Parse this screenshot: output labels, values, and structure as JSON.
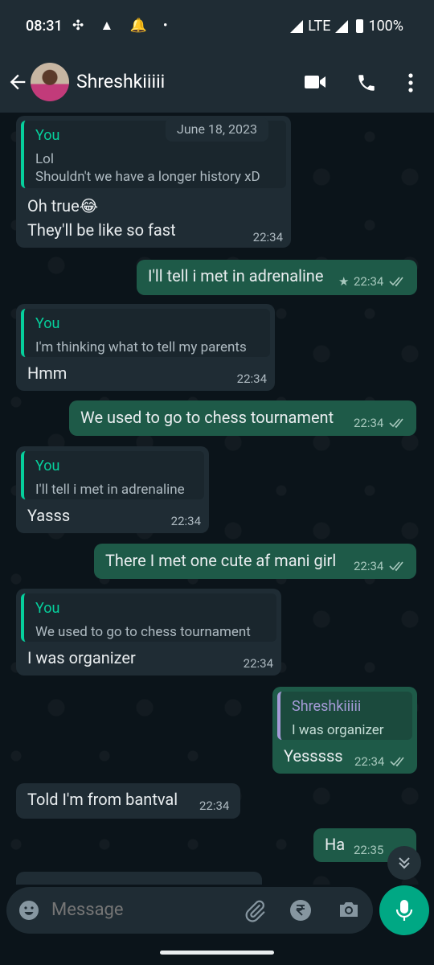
{
  "status": {
    "time": "08:31",
    "network": "LTE",
    "battery": "100%"
  },
  "header": {
    "contact_name": "Shreshkiiiii",
    "icons": [
      "back-arrow-icon",
      "video-call-icon",
      "voice-call-icon",
      "more-vert-icon"
    ]
  },
  "chat": {
    "date_chip": "June 18, 2023",
    "m1": {
      "quote_name": "You",
      "quote_line1": "Lol",
      "quote_line2": "Shouldn't we have a longer history xD",
      "line1": "Oh true😂",
      "line2": "They'll be like so fast",
      "time": "22:34"
    },
    "m2": {
      "text": "I'll tell i met in adrenaline",
      "time": "22:34",
      "starred": true
    },
    "m3": {
      "quote_name": "You",
      "quote_text": "I'm thinking what to tell my parents",
      "text": "Hmm",
      "time": "22:34"
    },
    "m4": {
      "text": "We used to go to chess tournament",
      "time": "22:34"
    },
    "m5": {
      "quote_name": "You",
      "quote_text": "I'll tell i met in adrenaline",
      "text": "Yasss",
      "time": "22:34"
    },
    "m6": {
      "text": "There I met one cute af mani girl",
      "time": "22:34"
    },
    "m7": {
      "quote_name": "You",
      "quote_text": "We used to go to chess tournament",
      "text": "I was organizer",
      "time": "22:34"
    },
    "m8": {
      "quote_name": "Shreshkiiiii",
      "quote_text": "I was organizer",
      "text": "Yesssss",
      "time": "22:34"
    },
    "m9": {
      "text": "Told I'm from bantval",
      "time": "22:34"
    },
    "m10": {
      "text": "Ha",
      "time": "22:35"
    }
  },
  "composer": {
    "placeholder": "Message"
  },
  "colors": {
    "header_bg": "#1f2c34",
    "chat_bg": "#0b141a",
    "incoming_bubble": "#1f2c34",
    "outgoing_bubble": "#1e5a48",
    "accent": "#00a884",
    "quote_you": "#06cf9c",
    "quote_contact": "#a59bd7"
  }
}
